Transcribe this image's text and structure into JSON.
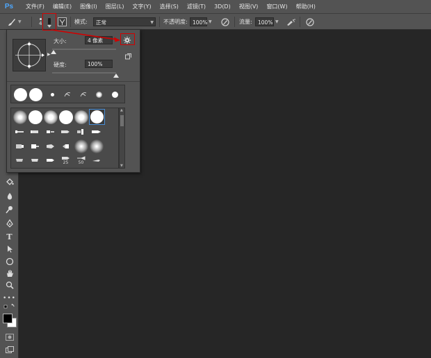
{
  "app": {
    "logo": "Ps"
  },
  "menu": [
    "文件(F)",
    "编辑(E)",
    "图像(I)",
    "图层(L)",
    "文字(Y)",
    "选择(S)",
    "滤镜(T)",
    "3D(D)",
    "视图(V)",
    "窗口(W)",
    "帮助(H)"
  ],
  "options": {
    "brush_size_value": "4",
    "mode_label": "模式:",
    "mode_value": "正常",
    "opacity_label": "不透明度:",
    "opacity_value": "100%",
    "flow_label": "流量:",
    "flow_value": "100%"
  },
  "brush_picker": {
    "size_label": "大小:",
    "size_value": "4 像素",
    "hardness_label": "硬度:",
    "hardness_value": "100%",
    "size_slider_level": 0.02,
    "hardness_slider_level": 1.0,
    "tip_numbers": [
      "25",
      "50"
    ]
  },
  "colors": {
    "menubar": "#535353",
    "canvas": "#262626",
    "highlight": "#d10000",
    "selected_tip": "#4a90d9"
  }
}
